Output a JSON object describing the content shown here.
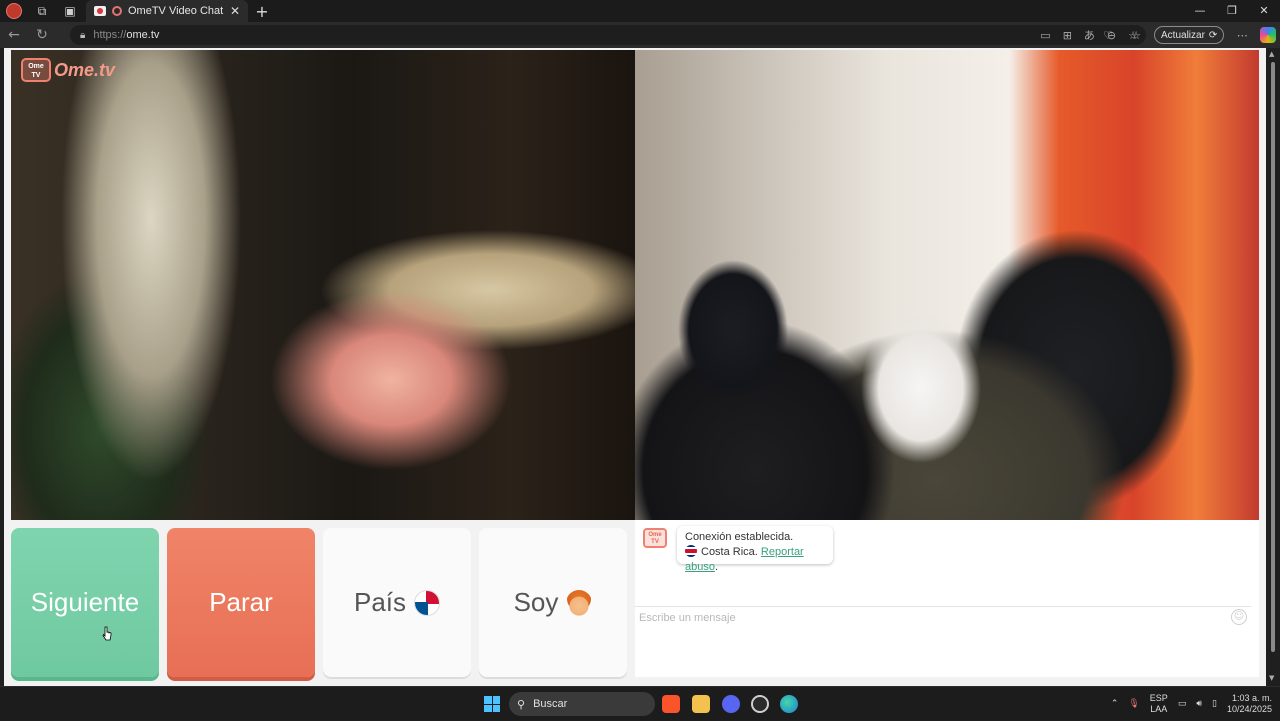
{
  "browser": {
    "tab_title": "OmeTV Video Chat — Omeg",
    "url_prefix": "https://",
    "url_host": "ome.tv",
    "update_label": "Actualizar"
  },
  "site": {
    "logo_badge": "Ome TV",
    "logo_text": "Ome.tv"
  },
  "controls": {
    "next_label": "Siguiente",
    "stop_label": "Parar",
    "country_label": "País",
    "gender_label": "Soy",
    "country_flag": "flag-panama",
    "gender_icon": "boy-avatar-icon"
  },
  "chat": {
    "system_badge": "Ome TV",
    "connection_text": "Conexión establecida.",
    "country_text": "Costa Rica.",
    "report_link": "Reportar abuso",
    "report_suffix": ".",
    "input_placeholder": "Escribe un mensaje"
  },
  "taskbar": {
    "search_label": "Buscar",
    "lang_top": "ESP",
    "lang_bottom": "LAA",
    "time": "1:03 a. m.",
    "date": "10/24/2025"
  },
  "colors": {
    "next_green": "#7fd4ae",
    "stop_red": "#f08468",
    "link_green": "#3aa17e",
    "brand_salmon": "#f08070"
  }
}
